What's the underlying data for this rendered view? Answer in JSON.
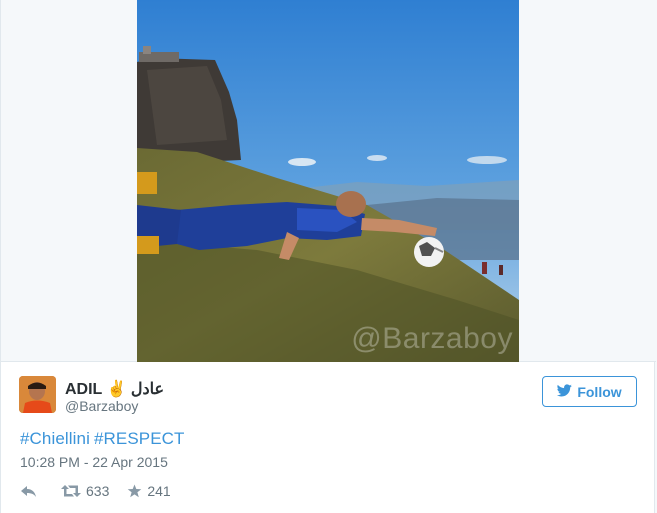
{
  "media": {
    "watermark": "@Barzaboy"
  },
  "tweet": {
    "user": {
      "name": "ADIL ✌ عادل",
      "handle": "@Barzaboy"
    },
    "follow_label": "Follow",
    "hashtags": [
      "#Chiellini",
      "#RESPECT"
    ],
    "timestamp": "10:28 PM - 22 Apr 2015",
    "stats": {
      "retweets": "633",
      "favorites": "241"
    }
  },
  "colors": {
    "accent": "#3b94d9",
    "secondary_text": "#66757f",
    "primary_text": "#292f33",
    "border": "#e1e8ed"
  },
  "icons": {
    "follow": "twitter-bird-icon",
    "reply": "reply-icon",
    "retweet": "retweet-icon",
    "favorite": "star-icon"
  }
}
